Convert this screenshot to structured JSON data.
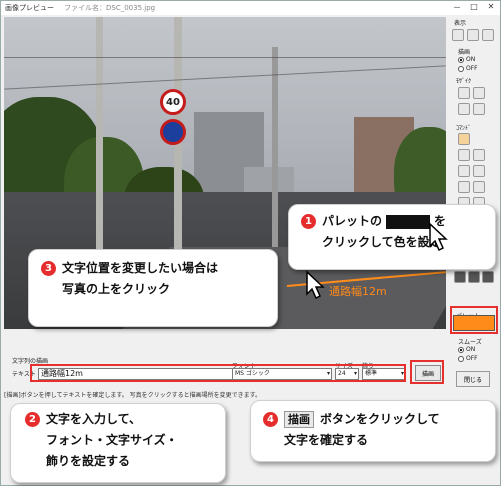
{
  "window": {
    "title": "画像プレビュー",
    "file_label": "ファイル名：DSC_0035.jpg",
    "min": "－",
    "max": "□",
    "close": "✕"
  },
  "photo": {
    "overlay_text": "通路幅12m",
    "sign_speed": "40"
  },
  "right_panel": {
    "display_label": "表示",
    "draw_label": "描画",
    "draw_on": "ON",
    "draw_off": "OFF",
    "mosaic_label": "ﾓｻﾞｲｸ",
    "command_label": "ｺﾏﾝﾄﾞ",
    "palette_label": "パレット",
    "palette_color": "#ff8c1a",
    "smooth_label": "スムーズ",
    "smooth_on": "ON",
    "smooth_off": "OFF",
    "close_label": "閉じる"
  },
  "bottom": {
    "section_label": "文字列の描画",
    "text_label": "テキスト",
    "text_value": "通路幅12m",
    "font_label": "フォント",
    "font_value": "MS ゴシック",
    "size_label": "サイズ",
    "size_value": "24",
    "decoration_label": "飾り",
    "decoration_value": "標準",
    "draw_button": "描画",
    "status_text": "[描画]ボタンを押してテキストを確定します。 写真をクリックすると描画場所を変更できます。"
  },
  "callouts": {
    "c1_num": "1",
    "c1_line1_pre": "パレットの",
    "c1_line1_post": "を",
    "c1_line2": "クリックして色を設定",
    "c2_num": "2",
    "c2_line1": "文字を入力して、",
    "c2_line2": "フォント・文字サイズ・",
    "c2_line3": "飾りを設定する",
    "c3_num": "3",
    "c3_line1": "文字位置を変更したい場合は",
    "c3_line2": "写真の上をクリック",
    "c4_num": "4",
    "c4_btn": "描画",
    "c4_line1_post": "ボタンをクリックして",
    "c4_line2": "文字を確定する"
  }
}
